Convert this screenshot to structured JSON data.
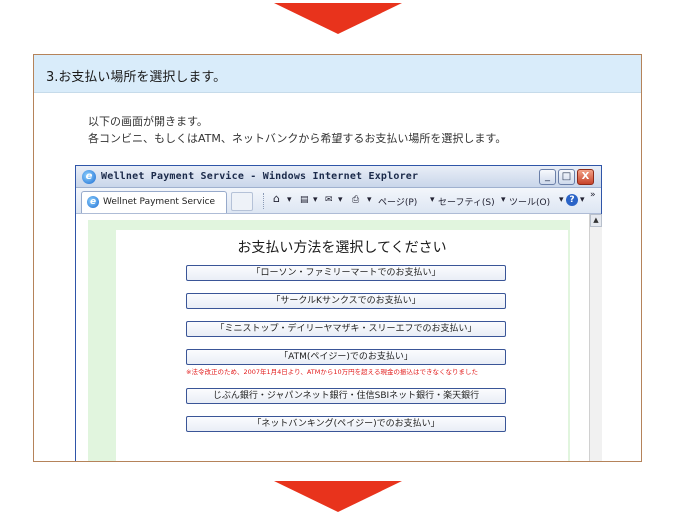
{
  "step": {
    "title": "3.お支払い場所を選択します。",
    "intro": [
      "以下の画面が開きます。",
      "各コンビニ、もしくはATM、ネットバンクから希望するお支払い場所を選択します。"
    ]
  },
  "browser": {
    "window_title": "Wellnet Payment Service - Windows Internet Explorer",
    "tab_label": "Wellnet Payment Service",
    "toolbar": {
      "home": "⌂",
      "rss": "▤",
      "mail": "✉",
      "print": "⎙",
      "page": "ページ(P)",
      "safety": "セーフティ(S)",
      "tools": "ツール(O)",
      "help": "?",
      "more": "»",
      "dropdown": "▾"
    },
    "window_buttons": {
      "minimize": "_",
      "maximize": "□",
      "close": "X"
    },
    "scroll_up": "▲"
  },
  "payment_page": {
    "title": "お支払い方法を選択してください",
    "options": [
      "「ローソン・ファミリーマートでのお支払い」",
      "「サークルKサンクスでのお支払い」",
      "「ミニストップ・デイリーヤマザキ・スリーエフでのお支払い」",
      "「ATM(ペイジー)でのお支払い」",
      "じぶん銀行・ジャパンネット銀行・住信SBIネット銀行・楽天銀行",
      "「ネットバンキング(ペイジー)でのお支払い」"
    ],
    "atm_notice": "※法令改正のため、2007年1月4日より、ATMから10万円を超える現金の振込はできなくなりました"
  },
  "colors": {
    "arrow": "#e8331c",
    "header_bg": "#d9ecfa",
    "card_border": "#b5835a",
    "page_green": "#e1f5de",
    "notice_red": "#e21c1c"
  }
}
